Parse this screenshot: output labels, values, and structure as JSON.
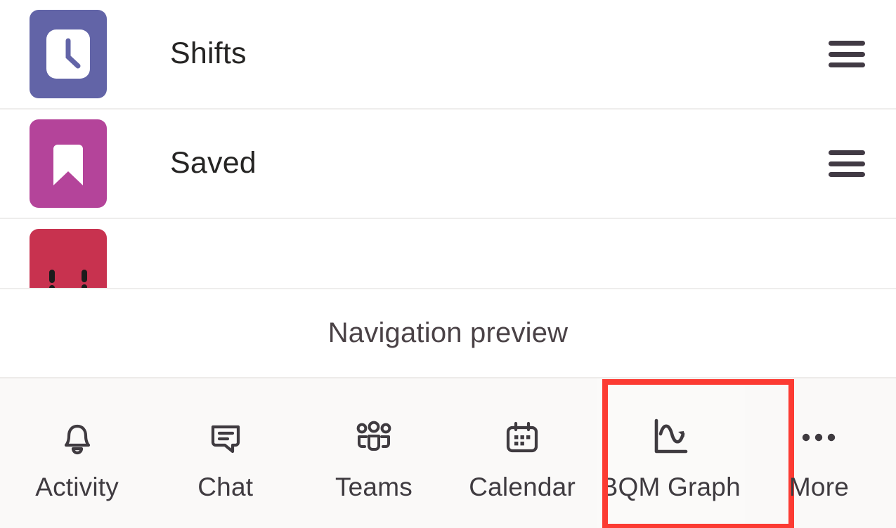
{
  "colors": {
    "shifts_tile": "#6264a7",
    "saved_tile": "#b4449a",
    "third_tile": "#c8324f",
    "nav_background": "#faf9f8",
    "page_background": "#ffffff",
    "highlight_box": "#fc3b33",
    "text_primary": "#252423",
    "text_secondary": "#4a4246",
    "handle": "#413a44"
  },
  "reorder_list": {
    "rows": [
      {
        "label": "Shifts",
        "icon": "clock-icon",
        "tile_color": "#6264a7",
        "handle": "drag-handle-icon"
      },
      {
        "label": "Saved",
        "icon": "bookmark-icon",
        "tile_color": "#b4449a",
        "handle": "drag-handle-icon"
      },
      {
        "label": "",
        "icon": "dashed-rectangle-icon",
        "tile_color": "#c8324f",
        "handle": ""
      }
    ]
  },
  "preview": {
    "caption": "Navigation preview"
  },
  "bottom_nav": {
    "items": [
      {
        "label": "Activity",
        "icon": "bell-icon",
        "highlighted": false
      },
      {
        "label": "Chat",
        "icon": "chat-bubble-icon",
        "highlighted": false
      },
      {
        "label": "Teams",
        "icon": "people-icon",
        "highlighted": false
      },
      {
        "label": "Calendar",
        "icon": "calendar-icon",
        "highlighted": false
      },
      {
        "label": "BQM Graph",
        "icon": "line-chart-icon",
        "highlighted": true
      },
      {
        "label": "More",
        "icon": "ellipsis-icon",
        "highlighted": false
      }
    ]
  }
}
